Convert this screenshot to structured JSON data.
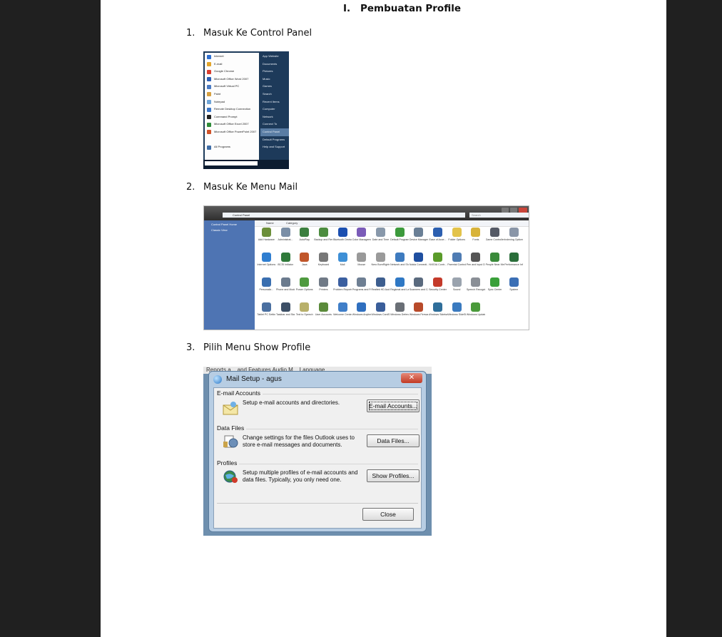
{
  "heading": {
    "number": "I.",
    "title": "Pembuatan Profile"
  },
  "steps": [
    {
      "number": "1.",
      "text": "Masuk Ke Control Panel"
    },
    {
      "number": "2.",
      "text": "Masuk Ke Menu Mail"
    },
    {
      "number": "3.",
      "text": "Pilih Menu Show Profile"
    }
  ],
  "start_menu": {
    "left_items": [
      {
        "label": "Internet",
        "color": "#2f6fd0"
      },
      {
        "label": "E-mail",
        "color": "#e3a52a"
      },
      {
        "label": "Google Chrome",
        "color": "#d93d2e"
      },
      {
        "label": "Microsoft Office Word 2007",
        "color": "#2b5fb5"
      },
      {
        "label": "Microsoft Virtual PC",
        "color": "#4a7bc4"
      },
      {
        "label": "Paint",
        "color": "#d6a040"
      },
      {
        "label": "Notepad",
        "color": "#6fa5d8"
      },
      {
        "label": "Remote Desktop Connection",
        "color": "#3a76c8"
      },
      {
        "label": "Command Prompt",
        "color": "#222222"
      },
      {
        "label": "Microsoft Office Excel 2007",
        "color": "#2e8b3a"
      },
      {
        "label": "Microsoft Office PowerPoint 2007",
        "color": "#d0532a"
      },
      {
        "label": "",
        "color": "#ffffff"
      },
      {
        "label": "All Programs",
        "color": "#3f6ea8"
      }
    ],
    "right_items": [
      "App Website",
      "Documents",
      "Pictures",
      "Music",
      "Games",
      "Search",
      "Recent Items",
      "Computer",
      "Network",
      "Connect To",
      "Control Panel",
      "Default Programs",
      "Help and Support"
    ],
    "highlighted_index": 10,
    "search_placeholder": "Start Search"
  },
  "control_panel": {
    "breadcrumb": "Control Panel",
    "search_placeholder": "Search",
    "nav": [
      "Control Panel Home",
      "Classic View"
    ],
    "columns": [
      "Name",
      "Category"
    ],
    "items": [
      {
        "label": "Add Hardware",
        "color": "#6c8f3a"
      },
      {
        "label": "Administrat...",
        "color": "#7a8ea6"
      },
      {
        "label": "AutoPlay",
        "color": "#3b7f3f"
      },
      {
        "label": "Backup and Restore C...",
        "color": "#4c8c3f"
      },
      {
        "label": "Bluetooth Devices",
        "color": "#1b4fb0"
      },
      {
        "label": "Color Management",
        "color": "#7a5bb8"
      },
      {
        "label": "Date and Time",
        "color": "#8898aa"
      },
      {
        "label": "Default Programs",
        "color": "#3c9a3c"
      },
      {
        "label": "Device Manager",
        "color": "#6a7f96"
      },
      {
        "label": "Ease of Acce...",
        "color": "#2c5fb0"
      },
      {
        "label": "Folder Options",
        "color": "#e3c34a"
      },
      {
        "label": "Fonts",
        "color": "#d8b339"
      },
      {
        "label": "Game Controllers",
        "color": "#555a66"
      },
      {
        "label": "Indexing Options",
        "color": "#8a96a8"
      },
      {
        "label": "Internet Options",
        "color": "#2f7ed0"
      },
      {
        "label": "iSCSI Initiator",
        "color": "#2f7a3a"
      },
      {
        "label": "Java",
        "color": "#c0562a"
      },
      {
        "label": "Keyboard",
        "color": "#777777"
      },
      {
        "label": "Mail",
        "color": "#3d8fd6"
      },
      {
        "label": "Mouse",
        "color": "#999999"
      },
      {
        "label": "Nero BurnRights",
        "color": "#9a9a9a"
      },
      {
        "label": "Network and Sharing Ce...",
        "color": "#3e7bbf"
      },
      {
        "label": "Nokia Connecti...",
        "color": "#1f4fa0"
      },
      {
        "label": "NVIDIA Contr...",
        "color": "#5a9b2a"
      },
      {
        "label": "Parental Controls",
        "color": "#4f7cb3"
      },
      {
        "label": "Pen and Input Devices",
        "color": "#555555"
      },
      {
        "label": "People Near Me",
        "color": "#3a8a3a"
      },
      {
        "label": "Performance Informatio...",
        "color": "#2a6e3a"
      },
      {
        "label": "Personaliz...",
        "color": "#3a6fb0"
      },
      {
        "label": "Phone and Modem ...",
        "color": "#6b7b8e"
      },
      {
        "label": "Power Options",
        "color": "#4f9a3f"
      },
      {
        "label": "Printers",
        "color": "#707a86"
      },
      {
        "label": "Problem Reports a...",
        "color": "#3b5fa0"
      },
      {
        "label": "Programs and Features",
        "color": "#6e7f93"
      },
      {
        "label": "Realtek HD Audio M...",
        "color": "#3d5e8f"
      },
      {
        "label": "Regional and Language ...",
        "color": "#2f78c4"
      },
      {
        "label": "Scanners and Cameras",
        "color": "#5a6a7e"
      },
      {
        "label": "Security Center",
        "color": "#c43a2a"
      },
      {
        "label": "Sound",
        "color": "#9aa3ae"
      },
      {
        "label": "Speech Recogniti...",
        "color": "#8a8f96"
      },
      {
        "label": "Sync Center",
        "color": "#3aa03a"
      },
      {
        "label": "System",
        "color": "#3b6fb5"
      },
      {
        "label": "Tablet PC Settings",
        "color": "#4a6fa0"
      },
      {
        "label": "Taskbar and Start Menu",
        "color": "#3d4f66"
      },
      {
        "label": "Text to Speech",
        "color": "#b8b06a"
      },
      {
        "label": "User Accounts",
        "color": "#5a8a3a"
      },
      {
        "label": "Welcome Center",
        "color": "#3f7ec8"
      },
      {
        "label": "Windows Anytim...",
        "color": "#2f6fbf"
      },
      {
        "label": "Windows CardSpace",
        "color": "#3a5e9a"
      },
      {
        "label": "Windows Defender",
        "color": "#6a6f76"
      },
      {
        "label": "Windows Firewall",
        "color": "#b84a2a"
      },
      {
        "label": "Windows Sidebar...",
        "color": "#2f6e9a"
      },
      {
        "label": "Windows SideShow",
        "color": "#3a7abf"
      },
      {
        "label": "Windows Update",
        "color": "#4a9a3a"
      }
    ]
  },
  "mail_setup": {
    "background_text": "Reports a...   and Features   Audio M...   Language ...",
    "title": "Mail Setup - agus",
    "close_glyph": "✕",
    "sections": [
      {
        "label": "E-mail Accounts",
        "text": "Setup e-mail accounts and directories.",
        "button": "E-mail Accounts..."
      },
      {
        "label": "Data Files",
        "text": "Change settings for the files Outlook uses to store e-mail messages and documents.",
        "button": "Data Files..."
      },
      {
        "label": "Profiles",
        "text": "Setup multiple profiles of e-mail accounts and data files. Typically, you only need one.",
        "button": "Show Profiles..."
      }
    ],
    "close_button": "Close"
  }
}
